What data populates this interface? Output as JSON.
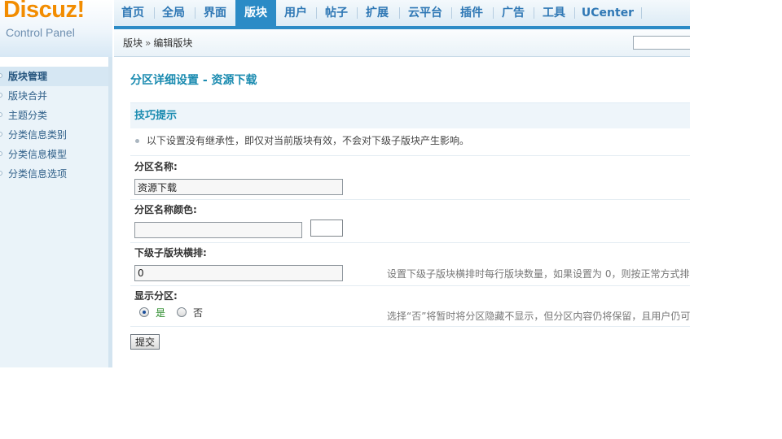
{
  "logo": {
    "brand": "Discuz!",
    "subtitle": "Control Panel"
  },
  "nav": {
    "items": [
      {
        "label": "首页"
      },
      {
        "label": "全局"
      },
      {
        "label": "界面"
      },
      {
        "label": "版块",
        "active": true
      },
      {
        "label": "用户"
      },
      {
        "label": "帖子"
      },
      {
        "label": "扩展"
      },
      {
        "label": "云平台"
      },
      {
        "label": "插件"
      },
      {
        "label": "广告"
      },
      {
        "label": "工具"
      },
      {
        "label": "UCenter"
      }
    ]
  },
  "breadcrumb": {
    "parent": "版块",
    "separator": "»",
    "current": "编辑版块"
  },
  "top_search": {
    "value": ""
  },
  "sidebar": {
    "items": [
      {
        "label": "版块管理",
        "active": true
      },
      {
        "label": "版块合并"
      },
      {
        "label": "主题分类"
      },
      {
        "label": "分类信息类别"
      },
      {
        "label": "分类信息模型"
      },
      {
        "label": "分类信息选项"
      }
    ]
  },
  "main": {
    "title": "分区详细设置 - 资源下载",
    "tips": {
      "title": "技巧提示",
      "text": "以下设置没有继承性，即仅对当前版块有效，不会对下级子版块产生影响。"
    },
    "fields": {
      "name": {
        "label": "分区名称:",
        "value": "资源下载"
      },
      "color": {
        "label": "分区名称颜色:",
        "value": ""
      },
      "columns": {
        "label": "下级子版块横排:",
        "value": "0",
        "hint": "设置下级子版块横排时每行版块数量，如果设置为 0，则按正常方式排"
      },
      "display": {
        "label": "显示分区:",
        "yes_label": "是",
        "no_label": "否",
        "selected": "yes",
        "hint": "选择“否”将暂时将分区隐藏不显示，但分区内容仍将保留，且用户仍可"
      }
    },
    "submit_label": "提交"
  },
  "colors": {
    "accent": "#2b8bc6",
    "title": "#1a8bb0",
    "logo": "#f28c00"
  }
}
